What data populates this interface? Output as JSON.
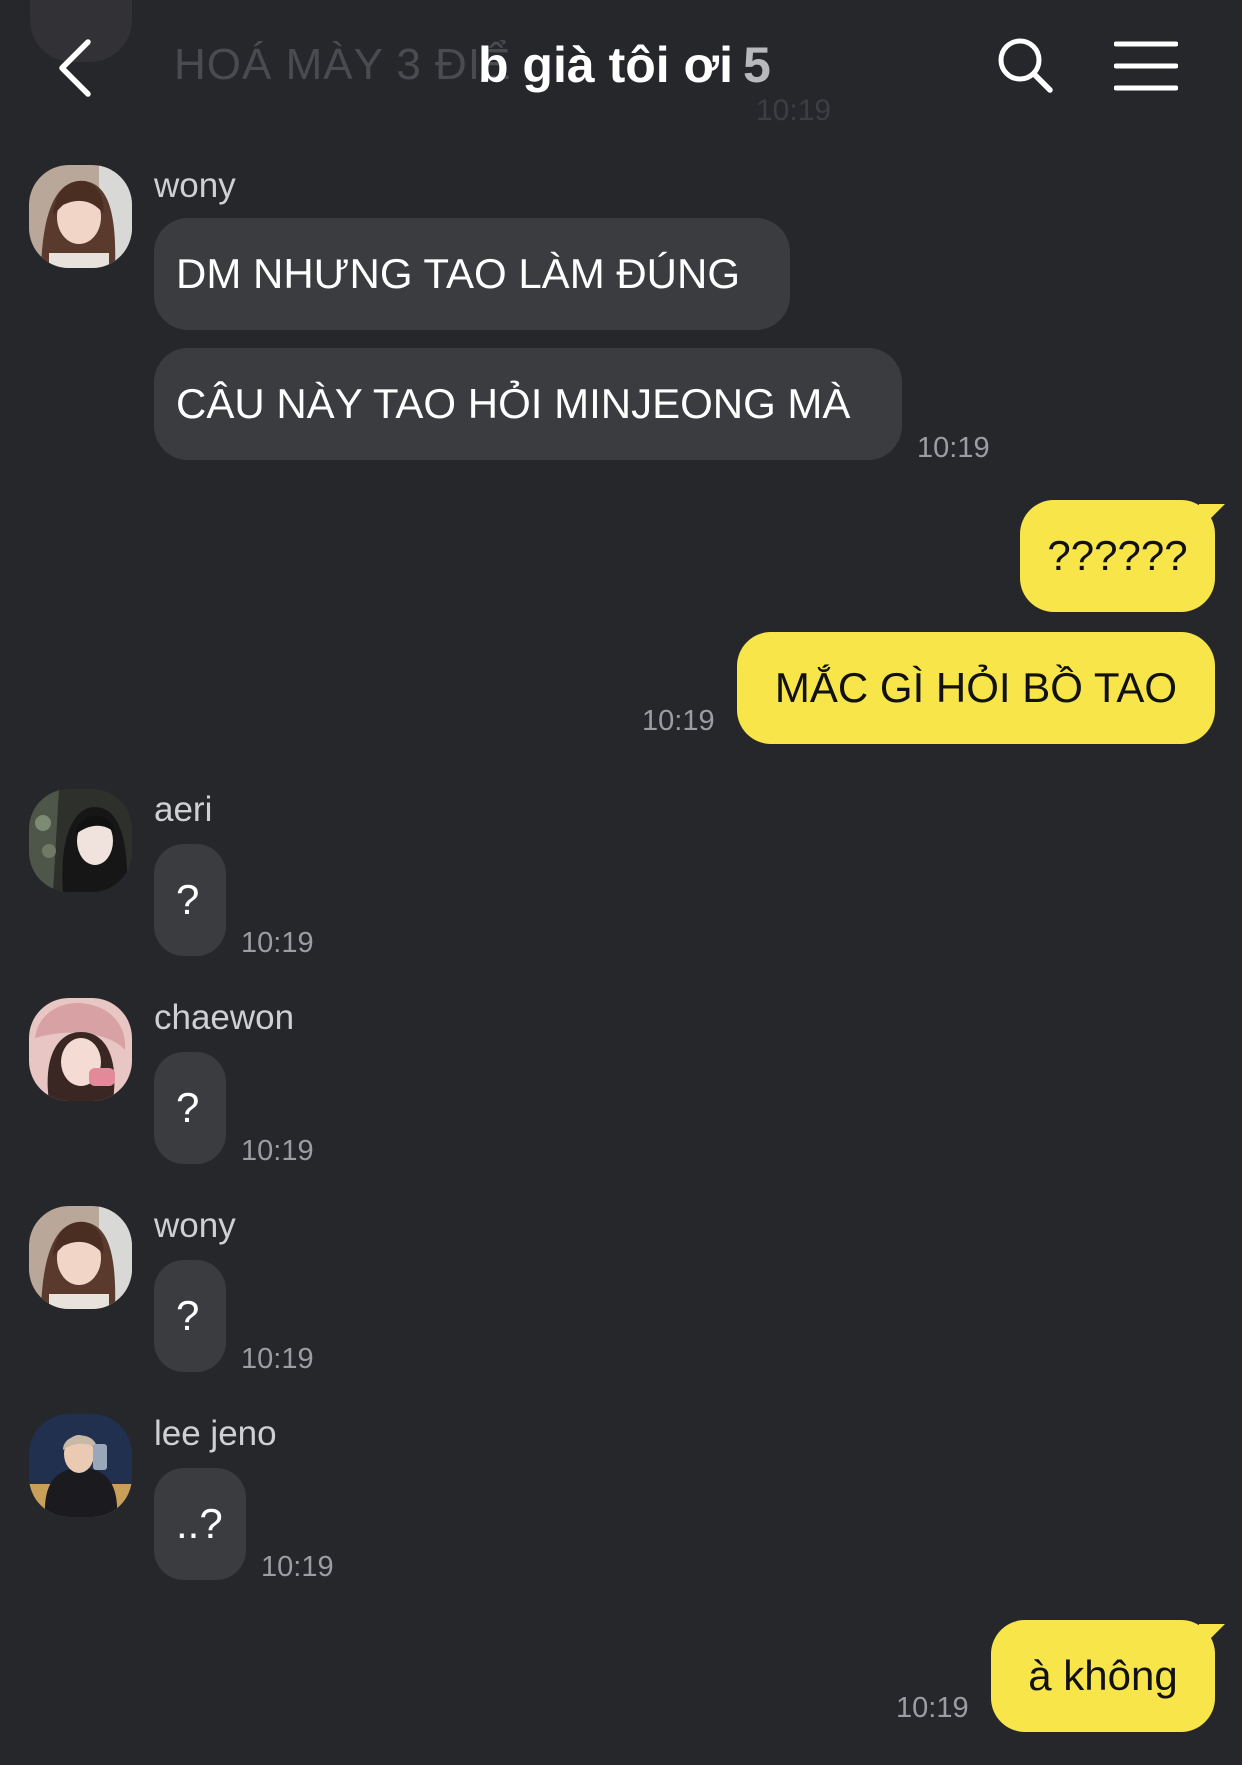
{
  "header": {
    "title": "b già tôi ơi",
    "member_count": "5",
    "background_preview_text": "HOÁ MÀY 3 ĐIỂ",
    "background_preview_time": "10:19",
    "back_icon": "chevron-left-icon",
    "search_icon": "search-icon",
    "menu_icon": "hamburger-menu-icon"
  },
  "colors": {
    "background": "#26272b",
    "incoming_bubble": "#3b3c40",
    "outgoing_bubble": "#f7e54a"
  },
  "messages": [
    {
      "sender": "wony",
      "direction": "incoming",
      "bubbles": [
        "DM NHƯNG TAO LÀM ĐÚNG",
        "CÂU NÀY TAO HỎI MINJEONG MÀ"
      ],
      "time": "10:19"
    },
    {
      "sender": "me",
      "direction": "outgoing",
      "bubbles": [
        "??????",
        "MẮC GÌ HỎI BỒ TAO"
      ],
      "time": "10:19"
    },
    {
      "sender": "aeri",
      "direction": "incoming",
      "bubbles": [
        "?"
      ],
      "time": "10:19"
    },
    {
      "sender": "chaewon",
      "direction": "incoming",
      "bubbles": [
        "?"
      ],
      "time": "10:19"
    },
    {
      "sender": "wony",
      "direction": "incoming",
      "bubbles": [
        "?"
      ],
      "time": "10:19"
    },
    {
      "sender": "lee jeno",
      "direction": "incoming",
      "bubbles": [
        "..?"
      ],
      "time": "10:19"
    },
    {
      "sender": "me",
      "direction": "outgoing",
      "bubbles": [
        "à không"
      ],
      "time": "10:19"
    }
  ]
}
